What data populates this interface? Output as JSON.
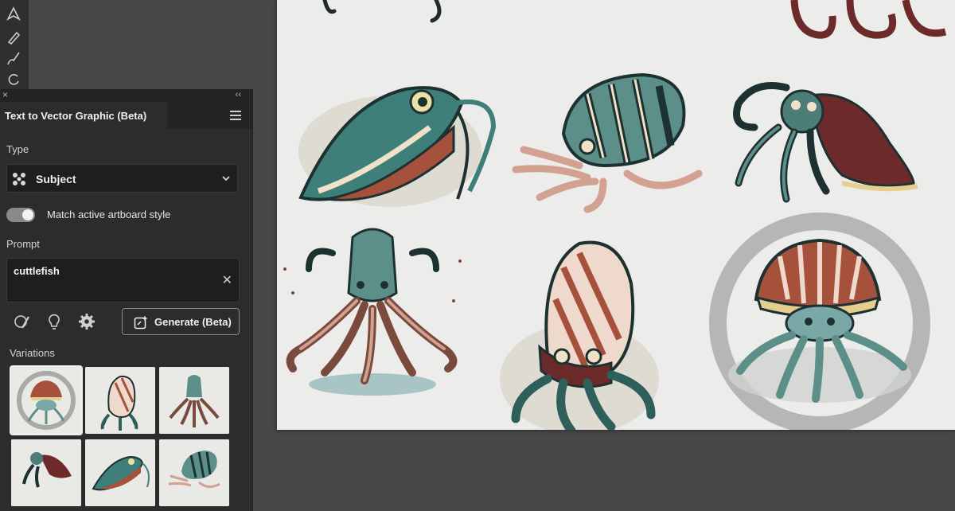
{
  "panel": {
    "title": "Text to Vector Graphic (Beta)",
    "type_label": "Type",
    "type_value": "Subject",
    "toggle_label": "Match active artboard style",
    "toggle_on": true,
    "prompt_label": "Prompt",
    "prompt_value": "cuttlefish",
    "generate_label": "Generate (Beta)",
    "variations_label": "Variations",
    "collapse_glyph": "‹‹",
    "close_glyph": "×",
    "clear_glyph": "✕"
  },
  "icons": {
    "type_icon": "subject-icon",
    "dropdown_icon": "chevron-down-icon",
    "menu_icon": "hamburger-menu-icon",
    "style_picker": "style-picker-icon",
    "suggest": "lightbulb-icon",
    "settings": "gear-icon",
    "generate": "sparkle-add-icon"
  },
  "colors": {
    "panel_bg": "#2c2c2c",
    "artboard_bg": "#ececea",
    "teal": "#3f7f7a",
    "rust": "#a5513c",
    "maroon": "#6d2a2a",
    "cream": "#efe2c8"
  }
}
